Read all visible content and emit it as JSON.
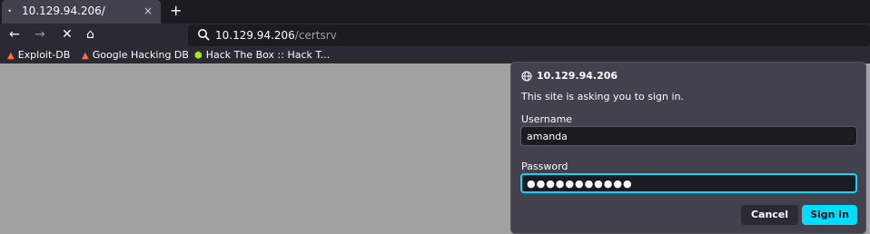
{
  "tab": {
    "title": "10.129.94.206/",
    "close": "×",
    "indicator": "•"
  },
  "new_tab": "+",
  "nav": {
    "back": "←",
    "forward": "→",
    "stop": "✕",
    "home": "⌂"
  },
  "url": {
    "host": "10.129.94.206",
    "path": "/certsrv"
  },
  "bookmarks": [
    {
      "label": "Exploit-DB",
      "icon": "flame-icon"
    },
    {
      "label": "Google Hacking DB",
      "icon": "flame-icon"
    },
    {
      "label": "Hack The Box :: Hack T...",
      "icon": "cube-icon"
    }
  ],
  "dialog": {
    "origin": "10.129.94.206",
    "message": "This site is asking you to sign in.",
    "username_label": "Username",
    "username_value": "amanda",
    "password_label": "Password",
    "password_value": "●●●●●●●●●●●",
    "cancel": "Cancel",
    "sign_in": "Sign in"
  },
  "colors": {
    "accent": "#00ddff",
    "toolbar": "#2b2a33",
    "content": "#a2a2a2"
  }
}
